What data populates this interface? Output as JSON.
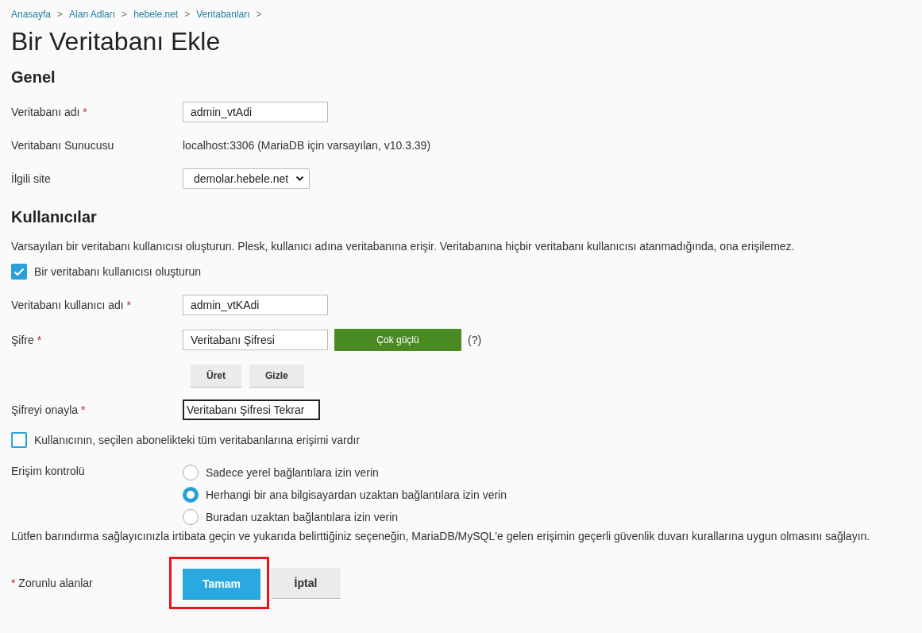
{
  "breadcrumb": [
    "Anasayfa",
    "Alan Adları",
    "hebele.net",
    "Veritabanları"
  ],
  "breadcrumb_separator": ">",
  "title": "Bir Veritabanı Ekle",
  "general": {
    "heading": "Genel",
    "db_name": {
      "label": "Veritabanı adı",
      "mark": "*",
      "value": "admin_vtAdi"
    },
    "db_server": {
      "label": "Veritabanı Sunucusu",
      "value": "localhost:3306 (MariaDB için varsayılan, v10.3.39)"
    },
    "site": {
      "label": "İlgili site",
      "value": "demolar.hebele.net"
    }
  },
  "users": {
    "heading": "Kullanıcılar",
    "description": "Varsayılan bir veritabanı kullanıcısı oluşturun. Plesk, kullanıcı adına veritabanına erişir. Veritabanına hiçbir veritabanı kullanıcısı atanmadığında, ona erişilemez.",
    "create_user": {
      "label": "Bir veritabanı kullanıcısı oluşturun",
      "checked": true
    },
    "username": {
      "label": "Veritabanı kullanıcı adı",
      "mark": "*",
      "value": "admin_vtKAdi"
    },
    "password": {
      "label": "Şifre",
      "mark": "*",
      "value": "Veritabanı Şifresi",
      "strength": {
        "kind": "very_strong",
        "label": "Çok güçlü"
      },
      "help": "(?)"
    },
    "password_buttons": [
      "Üret",
      "Gizle"
    ],
    "confirm": {
      "label": "Şifreyi onayla",
      "mark": "*",
      "value": "Veritabanı Şifresi Tekrar",
      "focused": true
    },
    "all_dbs": {
      "label": "Kullanıcının, seçilen abonelikteki tüm veritabanlarına erişimi vardır",
      "checked": false
    },
    "access": {
      "label": "Erişim kontrolü",
      "options": [
        {
          "label": "Sadece yerel bağlantılara izin verin",
          "selected": false
        },
        {
          "label": "Herhangi bir ana bilgisayardan uzaktan bağlantılara izin verin",
          "selected": true
        },
        {
          "label": "Buradan uzaktan bağlantılara izin verin",
          "selected": false
        }
      ]
    },
    "note": "Lütfen barındırma sağlayıcınızla irtibata geçin ve yukarıda belirttiğiniz seçeneğin, MariaDB/MySQL'e gelen erişimin geçerli güvenlik duvarı kurallarına uygun olmasını sağlayın."
  },
  "footer": {
    "mark": "*",
    "label": "Zorunlu alanlar",
    "ok": {
      "label": "Tamam",
      "highlighted": true
    },
    "cancel": "İptal"
  }
}
